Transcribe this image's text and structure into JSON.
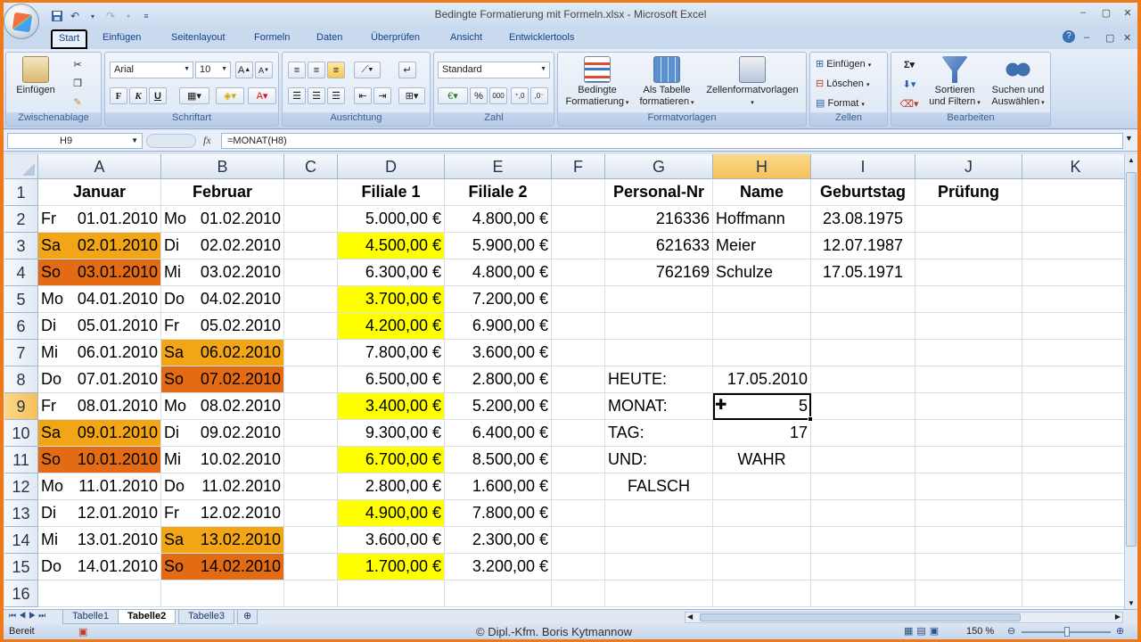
{
  "window": {
    "title": "Bedingte Formatierung mit Formeln.xlsx - Microsoft Excel",
    "controls": [
      "‒",
      "▢",
      "✕"
    ]
  },
  "ribbon": {
    "tabs": [
      "Start",
      "Einfügen",
      "Seitenlayout",
      "Formeln",
      "Daten",
      "Überprüfen",
      "Ansicht",
      "Entwicklertools"
    ],
    "active_tab": "Start",
    "groups": {
      "clipboard": {
        "label": "Zwischenablage",
        "paste": "Einfügen"
      },
      "font": {
        "label": "Schriftart",
        "font_name": "Arial",
        "font_size": "10",
        "bold": "F",
        "italic": "K",
        "underline": "U"
      },
      "alignment": {
        "label": "Ausrichtung"
      },
      "number": {
        "label": "Zahl",
        "format": "Standard",
        "percent": "%",
        "thousands": "000"
      },
      "styles": {
        "label": "Formatvorlagen",
        "cond_format_1": "Bedingte",
        "cond_format_2": "Formatierung",
        "table_1": "Als Tabelle",
        "table_2": "formatieren",
        "cell_styles": "Zellenformatvorlagen"
      },
      "cells": {
        "label": "Zellen",
        "insert": "Einfügen",
        "delete": "Löschen",
        "format": "Format"
      },
      "editing": {
        "label": "Bearbeiten",
        "sort_1": "Sortieren",
        "sort_2": "und Filtern",
        "find_1": "Suchen und",
        "find_2": "Auswählen"
      }
    }
  },
  "formula_bar": {
    "name_box": "H9",
    "fx": "fx",
    "formula": "=MONAT(H8)"
  },
  "columns": [
    "A",
    "B",
    "C",
    "D",
    "E",
    "F",
    "G",
    "H",
    "I",
    "J",
    "K"
  ],
  "selected_column": "H",
  "selected_row": "9",
  "rows": [
    "1",
    "2",
    "3",
    "4",
    "5",
    "6",
    "7",
    "8",
    "9",
    "10",
    "11",
    "12",
    "13",
    "14",
    "15",
    "16"
  ],
  "headers": {
    "A": "Januar",
    "B": "Februar",
    "D": "Filiale 1",
    "E": "Filiale 2",
    "G": "Personal-Nr",
    "H": "Name",
    "I": "Geburtstag",
    "J": "Prüfung"
  },
  "january": [
    {
      "day": "Fr",
      "date": "01.01.2010",
      "fill": ""
    },
    {
      "day": "Sa",
      "date": "02.01.2010",
      "fill": "o1"
    },
    {
      "day": "So",
      "date": "03.01.2010",
      "fill": "o2"
    },
    {
      "day": "Mo",
      "date": "04.01.2010",
      "fill": ""
    },
    {
      "day": "Di",
      "date": "05.01.2010",
      "fill": ""
    },
    {
      "day": "Mi",
      "date": "06.01.2010",
      "fill": ""
    },
    {
      "day": "Do",
      "date": "07.01.2010",
      "fill": ""
    },
    {
      "day": "Fr",
      "date": "08.01.2010",
      "fill": ""
    },
    {
      "day": "Sa",
      "date": "09.01.2010",
      "fill": "o1"
    },
    {
      "day": "So",
      "date": "10.01.2010",
      "fill": "o2"
    },
    {
      "day": "Mo",
      "date": "11.01.2010",
      "fill": ""
    },
    {
      "day": "Di",
      "date": "12.01.2010",
      "fill": ""
    },
    {
      "day": "Mi",
      "date": "13.01.2010",
      "fill": ""
    },
    {
      "day": "Do",
      "date": "14.01.2010",
      "fill": ""
    }
  ],
  "february": [
    {
      "day": "Mo",
      "date": "01.02.2010",
      "fill": ""
    },
    {
      "day": "Di",
      "date": "02.02.2010",
      "fill": ""
    },
    {
      "day": "Mi",
      "date": "03.02.2010",
      "fill": ""
    },
    {
      "day": "Do",
      "date": "04.02.2010",
      "fill": ""
    },
    {
      "day": "Fr",
      "date": "05.02.2010",
      "fill": ""
    },
    {
      "day": "Sa",
      "date": "06.02.2010",
      "fill": "o1"
    },
    {
      "day": "So",
      "date": "07.02.2010",
      "fill": "o2"
    },
    {
      "day": "Mo",
      "date": "08.02.2010",
      "fill": ""
    },
    {
      "day": "Di",
      "date": "09.02.2010",
      "fill": ""
    },
    {
      "day": "Mi",
      "date": "10.02.2010",
      "fill": ""
    },
    {
      "day": "Do",
      "date": "11.02.2010",
      "fill": ""
    },
    {
      "day": "Fr",
      "date": "12.02.2010",
      "fill": ""
    },
    {
      "day": "Sa",
      "date": "13.02.2010",
      "fill": "o1"
    },
    {
      "day": "So",
      "date": "14.02.2010",
      "fill": "o2"
    }
  ],
  "filiale1": [
    {
      "v": "5.000,00 €",
      "fill": ""
    },
    {
      "v": "4.500,00 €",
      "fill": "y"
    },
    {
      "v": "6.300,00 €",
      "fill": ""
    },
    {
      "v": "3.700,00 €",
      "fill": "y"
    },
    {
      "v": "4.200,00 €",
      "fill": "y"
    },
    {
      "v": "7.800,00 €",
      "fill": ""
    },
    {
      "v": "6.500,00 €",
      "fill": ""
    },
    {
      "v": "3.400,00 €",
      "fill": "y"
    },
    {
      "v": "9.300,00 €",
      "fill": ""
    },
    {
      "v": "6.700,00 €",
      "fill": "y"
    },
    {
      "v": "2.800,00 €",
      "fill": ""
    },
    {
      "v": "4.900,00 €",
      "fill": "y"
    },
    {
      "v": "3.600,00 €",
      "fill": ""
    },
    {
      "v": "1.700,00 €",
      "fill": "y"
    }
  ],
  "filiale2": [
    "4.800,00 €",
    "5.900,00 €",
    "4.800,00 €",
    "7.200,00 €",
    "6.900,00 €",
    "3.600,00 €",
    "2.800,00 €",
    "5.200,00 €",
    "6.400,00 €",
    "8.500,00 €",
    "1.600,00 €",
    "7.800,00 €",
    "2.300,00 €",
    "3.200,00 €"
  ],
  "personnel": [
    {
      "nr": "216336",
      "name": "Hoffmann",
      "birthday": "23.08.1975"
    },
    {
      "nr": "621633",
      "name": "Meier",
      "birthday": "12.07.1987"
    },
    {
      "nr": "762169",
      "name": "Schulze",
      "birthday": "17.05.1971"
    }
  ],
  "calc": {
    "heute_label": "HEUTE:",
    "heute_value": "17.05.2010",
    "monat_label": "MONAT:",
    "monat_value": "5",
    "tag_label": "TAG:",
    "tag_value": "17",
    "und_label": "UND:",
    "und_value": "WAHR",
    "falsch": "FALSCH"
  },
  "sheets": [
    "Tabelle1",
    "Tabelle2",
    "Tabelle3"
  ],
  "active_sheet": "Tabelle2",
  "status": {
    "mode": "Bereit",
    "credit": "© Dipl.-Kfm. Boris Kytmannow",
    "zoom": "150 %"
  }
}
